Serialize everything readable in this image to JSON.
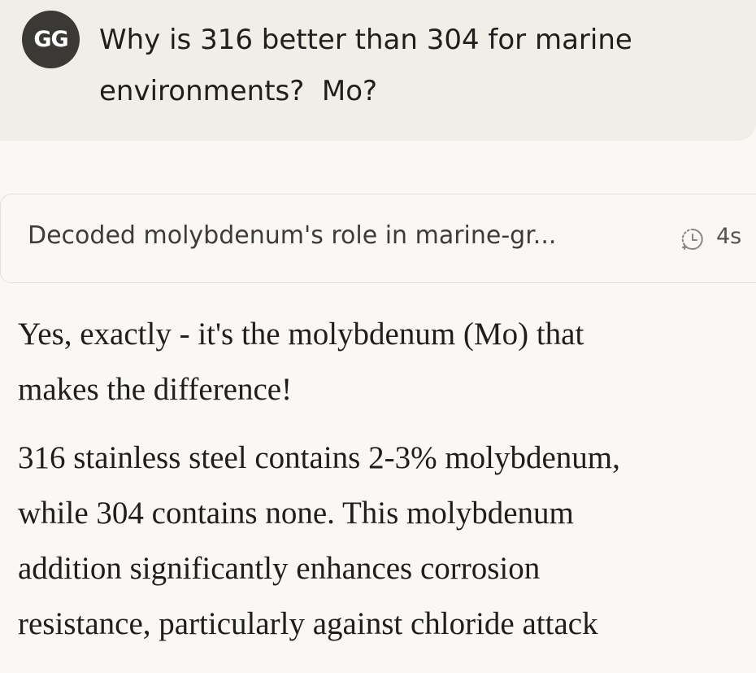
{
  "user_message": {
    "avatar_initials": "GG",
    "text": "Why is 316 better than 304 for marine\nenvironments?  Mo?"
  },
  "thinking": {
    "summary": "Decoded molybdenum's role in marine-gr...",
    "duration": "4s",
    "icon": "timer-icon"
  },
  "response": {
    "paragraph_1": "Yes, exactly - it's the molybdenum (Mo) that\nmakes the difference!",
    "paragraph_2": "316 stainless steel contains 2-3% molybdenum,\nwhile 304 contains none. This molybdenum\naddition significantly enhances corrosion\nresistance, particularly against chloride attack"
  },
  "colors": {
    "background": "#f9f8f4",
    "user_bubble": "#f0eee6",
    "avatar": "#3a3936"
  }
}
